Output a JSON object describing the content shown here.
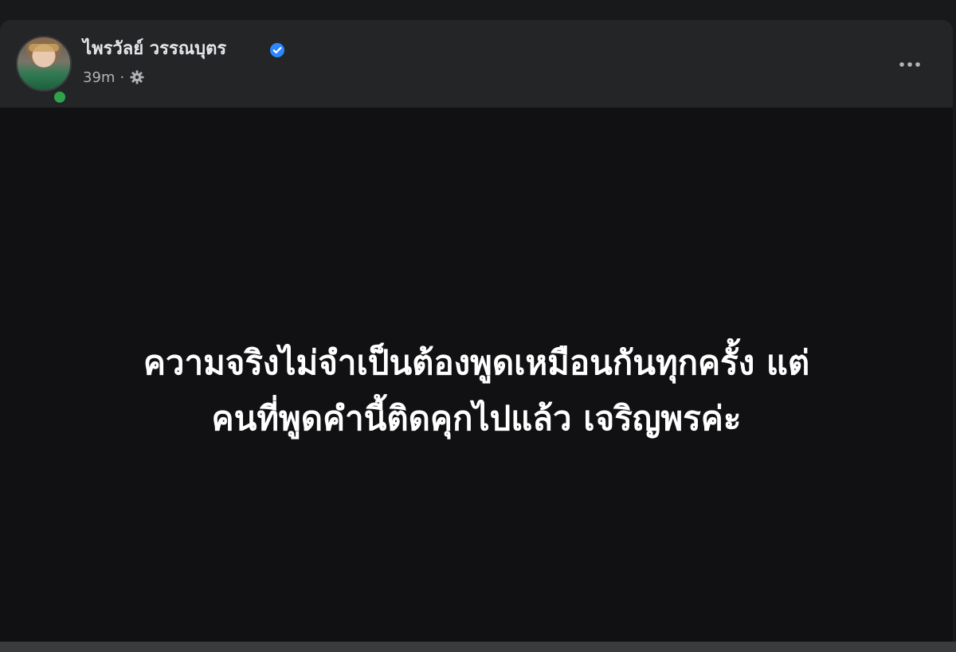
{
  "post": {
    "author": "ไพรวัลย์ วรรณบุตร",
    "verified": true,
    "time": "39m",
    "separator": "·",
    "privacy_icon": "gear-icon",
    "more_icon": "ellipsis-icon",
    "text_lines": [
      "ความจริงไม่จำเป็นต้องพูดเหมือนกันทุกครั้ง แต่",
      "คนที่พูดคำนี้ติดคุกไปแล้ว เจริญพรค่ะ"
    ]
  },
  "colors": {
    "page_bg": "#18191a",
    "card_bg": "#242526",
    "body_bg": "#111113",
    "text_primary": "#e4e6eb",
    "text_secondary": "#b0b3b8",
    "verified": "#2d88ff",
    "online": "#31a24c"
  }
}
